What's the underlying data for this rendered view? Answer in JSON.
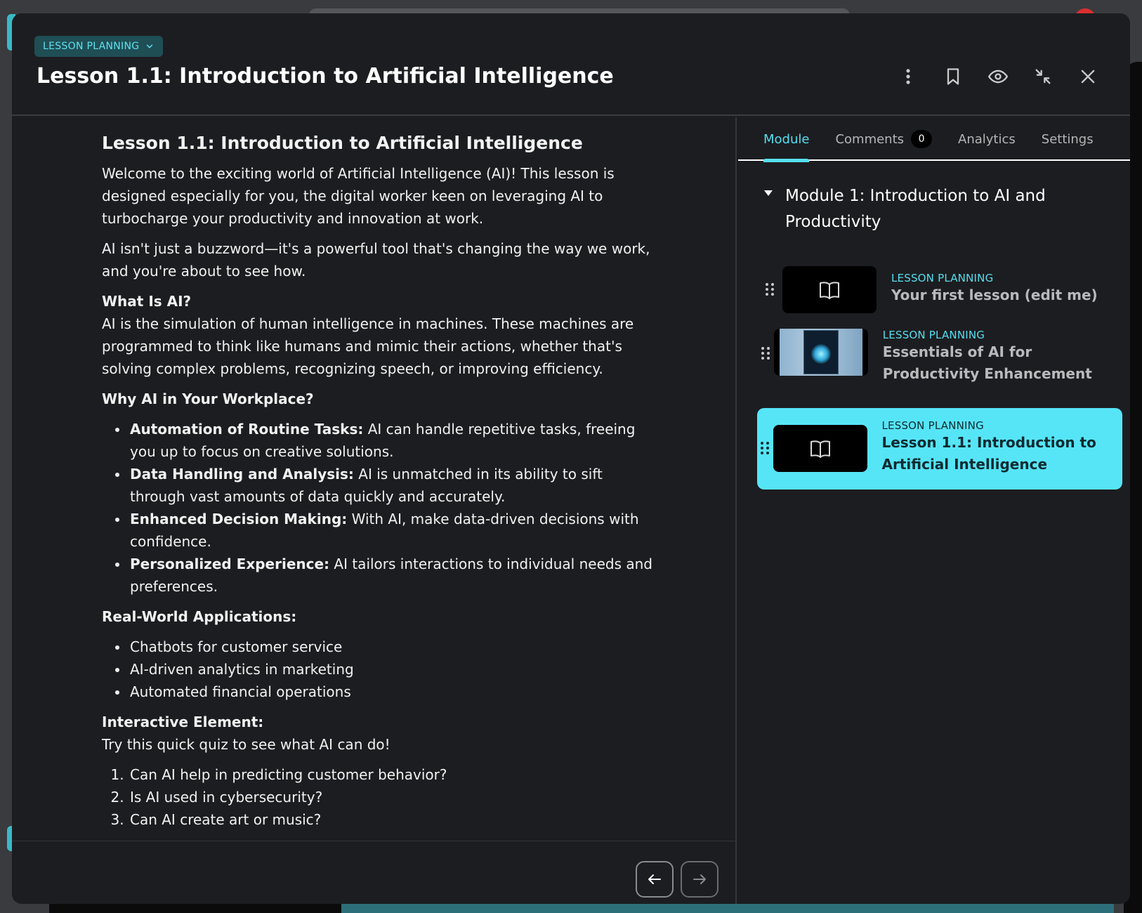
{
  "header": {
    "badge": "LESSON PLANNING",
    "title": "Lesson 1.1: Introduction to Artificial Intelligence",
    "icons": [
      "more-vertical-icon",
      "bookmark-icon",
      "eye-icon",
      "minimize-icon",
      "close-icon"
    ]
  },
  "article": {
    "title": "Lesson 1.1: Introduction to Artificial Intelligence",
    "intro": "Welcome to the exciting world of Artificial Intelligence (AI)! This lesson is designed especially for you, the digital worker keen on leveraging AI to turbocharge your productivity and innovation at work.",
    "intro2": "AI isn't just a buzzword—it's a powerful tool that's changing the way we work, and you're about to see how.",
    "what_heading": "What Is AI?",
    "what_body": "AI is the simulation of human intelligence in machines. These machines are programmed to think like humans and mimic their actions, whether that's solving complex problems, recognizing speech, or improving efficiency.",
    "why_heading": "Why AI in Your Workplace?",
    "why_items": [
      {
        "bold": "Automation of Routine Tasks:",
        "text": " AI can handle repetitive tasks, freeing you up to focus on creative solutions."
      },
      {
        "bold": "Data Handling and Analysis:",
        "text": " AI is unmatched in its ability to sift through vast amounts of data quickly and accurately."
      },
      {
        "bold": "Enhanced Decision Making:",
        "text": " With AI, make data-driven decisions with confidence."
      },
      {
        "bold": "Personalized Experience:",
        "text": " AI tailors interactions to individual needs and preferences."
      }
    ],
    "apps_heading": "Real-World Applications:",
    "apps_items": [
      "Chatbots for customer service",
      "AI-driven analytics in marketing",
      "Automated financial operations"
    ],
    "interactive_heading": "Interactive Element:",
    "interactive_body": "Try this quick quiz to see what AI can do!",
    "quiz_items": [
      "Can AI help in predicting customer behavior?",
      "Is AI used in cybersecurity?",
      "Can AI create art or music?"
    ]
  },
  "footer": {
    "prev_icon": "arrow-left-icon",
    "next_icon": "arrow-right-icon"
  },
  "sidebar": {
    "tabs": [
      {
        "label": "Module",
        "active": true
      },
      {
        "label": "Comments",
        "count": "0"
      },
      {
        "label": "Analytics"
      },
      {
        "label": "Settings"
      }
    ],
    "module_title": "Module 1: Introduction to AI and Productivity",
    "lessons": [
      {
        "kicker": "LESSON PLANNING",
        "title": "Your first lesson (edit me)",
        "thumb": "book-icon",
        "selected": false
      },
      {
        "kicker": "LESSON PLANNING",
        "title": "Essentials of AI for Productivity Enhancement",
        "thumb": "book-cover-image",
        "selected": false
      },
      {
        "kicker": "LESSON PLANNING",
        "title": "Lesson 1.1: Introduction to Artificial Intelligence",
        "thumb": "book-icon",
        "selected": true
      }
    ]
  },
  "colors": {
    "accent": "#56dff0",
    "selected_bg": "#56e5f7",
    "modal_bg": "#1c1d20"
  }
}
